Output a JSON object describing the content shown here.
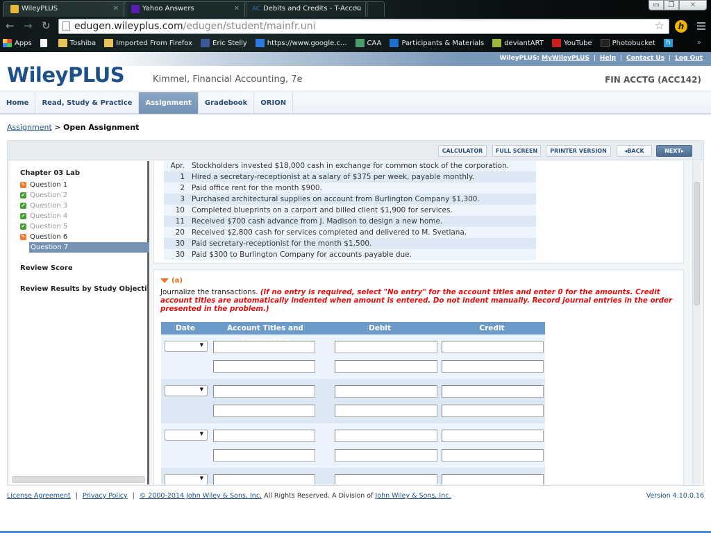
{
  "browser": {
    "tabs": [
      {
        "title": "WileyPLUS",
        "favicon": "wileyplus-check-icon",
        "color": "#e9b83a",
        "active": true
      },
      {
        "title": "Yahoo Answers",
        "favicon": "yahoo-icon",
        "color": "#5a1db3",
        "active": false
      },
      {
        "title": "Debits and Credits - T-Accou",
        "favicon": "ac-icon",
        "color": "#3b6ea8",
        "active": false
      }
    ],
    "url_host": "edugen.wileyplus.com",
    "url_path": "/edugen/student/mainfr.uni",
    "bookmarks": [
      {
        "label": "Apps",
        "icon": "apps-grid-icon"
      },
      {
        "label": "",
        "icon": "page-icon"
      },
      {
        "label": "Toshiba",
        "icon": "folder-icon"
      },
      {
        "label": "Imported From Firefox",
        "icon": "folder-icon"
      },
      {
        "label": "Eric Stelly",
        "icon": "facebook-icon"
      },
      {
        "label": "https://www.google.c...",
        "icon": "phone-icon"
      },
      {
        "label": "CAA",
        "icon": "caa-icon"
      },
      {
        "label": "Participants & Materials",
        "icon": "sharepoint-icon"
      },
      {
        "label": "deviantART",
        "icon": "deviantart-icon"
      },
      {
        "label": "YouTube",
        "icon": "youtube-icon"
      },
      {
        "label": "Photobucket",
        "icon": "photobucket-icon"
      },
      {
        "label": "",
        "icon": "h-icon"
      }
    ],
    "more_bookmarks": "»"
  },
  "header": {
    "prefix": "WileyPLUS:",
    "links": [
      "MyWileyPLUS",
      "Help",
      "Contact Us",
      "Log Out"
    ],
    "logo": "WileyPLUS",
    "course_title": "Kimmel, Financial Accounting, 7e",
    "course_code": "FIN ACCTG (ACC142)"
  },
  "nav": {
    "items": [
      "Home",
      "Read, Study & Practice",
      "Assignment",
      "Gradebook",
      "ORION"
    ],
    "active": "Assignment"
  },
  "breadcrumb": {
    "link": "Assignment",
    "separator": ">",
    "current": "Open Assignment"
  },
  "toolbar": {
    "calculator": "CALCULATOR",
    "full_screen": "FULL SCREEN",
    "printer": "PRINTER VERSION",
    "back": "◂BACK",
    "next": "NEXT▸"
  },
  "sidebar": {
    "title": "Chapter 03 Lab",
    "questions": [
      {
        "label": "Question 1",
        "status": "partial"
      },
      {
        "label": "Question 2",
        "status": "complete"
      },
      {
        "label": "Question 3",
        "status": "complete"
      },
      {
        "label": "Question 4",
        "status": "complete"
      },
      {
        "label": "Question 5",
        "status": "complete"
      },
      {
        "label": "Question 6",
        "status": "partial"
      },
      {
        "label": "Question 7",
        "status": "selected"
      }
    ],
    "review_score": "Review Score",
    "review_results": "Review Results by Study Objecti"
  },
  "transactions": [
    {
      "date": "Apr. 1",
      "text": "Stockholders invested $18,000 cash in exchange for common stock of the corporation."
    },
    {
      "date": "1",
      "text": "Hired a secretary-receptionist at a salary of $375 per week, payable monthly."
    },
    {
      "date": "2",
      "text": "Paid office rent for the month $900."
    },
    {
      "date": "3",
      "text": "Purchased architectural supplies on account from Burlington Company $1,300."
    },
    {
      "date": "10",
      "text": "Completed blueprints on a carport and billed client $1,900 for services."
    },
    {
      "date": "11",
      "text": "Received $700 cash advance from J. Madison to design a new home."
    },
    {
      "date": "20",
      "text": "Received $2,800 cash for services completed and delivered to M. Svetlana."
    },
    {
      "date": "30",
      "text": "Paid secretary-receptionist for the month $1,500."
    },
    {
      "date": "30",
      "text": "Paid $300 to Burlington Company for accounts payable due."
    }
  ],
  "question": {
    "part": "(a)",
    "instruction": "Journalize the transactions.",
    "note": "(If no entry is required, select \"No entry\" for the account titles and enter 0 for the amounts. Credit account titles are automatically indented when amount is entered. Do not indent manually. Record journal entries in the order presented in the problem.)"
  },
  "journal": {
    "columns": [
      "Date",
      "Account Titles and Explanation",
      "Debit",
      "Credit"
    ],
    "entries": [
      {
        "date": "",
        "lines": [
          {
            "account": "",
            "debit": "",
            "credit": ""
          },
          {
            "account": "",
            "debit": "",
            "credit": ""
          }
        ]
      },
      {
        "date": "",
        "lines": [
          {
            "account": "",
            "debit": "",
            "credit": ""
          },
          {
            "account": "",
            "debit": "",
            "credit": ""
          }
        ]
      },
      {
        "date": "",
        "lines": [
          {
            "account": "",
            "debit": "",
            "credit": ""
          },
          {
            "account": "",
            "debit": "",
            "credit": ""
          }
        ]
      },
      {
        "date": "",
        "lines": [
          {
            "account": "",
            "debit": "",
            "credit": ""
          },
          {
            "account": "",
            "debit": "",
            "credit": ""
          }
        ]
      }
    ]
  },
  "footer": {
    "license": "License Agreement",
    "privacy": "Privacy Policy",
    "copyright": "© 2000-2014 John Wiley & Sons, Inc.",
    "rights": "All Rights Reserved. A Division of",
    "company": "John Wiley & Sons, Inc.",
    "version": "Version 4.10.0.16"
  }
}
